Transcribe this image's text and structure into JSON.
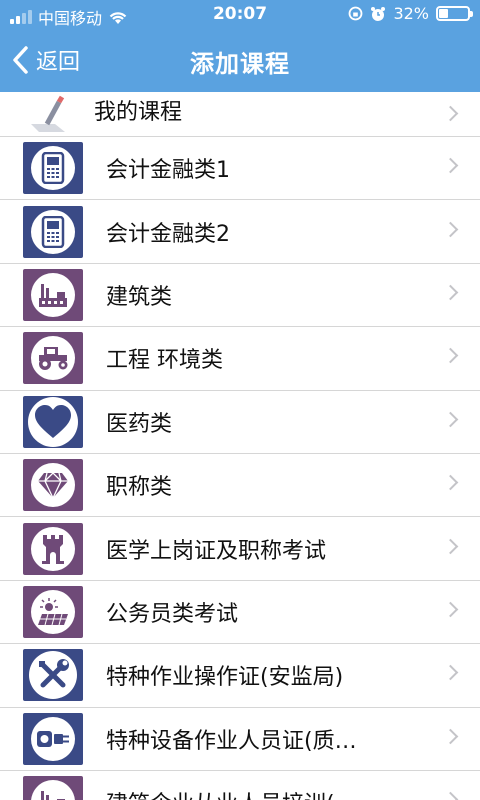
{
  "status_bar": {
    "carrier": "中国移动",
    "time": "20:07",
    "battery": "32%"
  },
  "nav": {
    "back_label": "返回",
    "title": "添加课程"
  },
  "list": {
    "header_item": "我的课程",
    "items": [
      {
        "label": "会计金融类1",
        "icon": "phone-icon",
        "color": "#3a4a86"
      },
      {
        "label": "会计金融类2",
        "icon": "phone-icon",
        "color": "#3a4a86"
      },
      {
        "label": "建筑类",
        "icon": "factory-icon",
        "color": "#6f4a78"
      },
      {
        "label": "工程 环境类",
        "icon": "tractor-icon",
        "color": "#6f4a78"
      },
      {
        "label": "医药类",
        "icon": "heart-icon",
        "color": "#3a4a86"
      },
      {
        "label": "职称类",
        "icon": "diamond-icon",
        "color": "#6f4a78"
      },
      {
        "label": "医学上岗证及职称考试",
        "icon": "tower-icon",
        "color": "#6f4a78"
      },
      {
        "label": "公务员类考试",
        "icon": "solar-icon",
        "color": "#6f4a78"
      },
      {
        "label": "特种作业操作证(安监局)",
        "icon": "tools-icon",
        "color": "#3a4a86"
      },
      {
        "label": "特种设备作业人员证(质…",
        "icon": "plug-icon",
        "color": "#3a4a86"
      },
      {
        "label": "建筑企业从业人员培训(",
        "icon": "factory-icon",
        "color": "#6f4a78"
      }
    ]
  }
}
